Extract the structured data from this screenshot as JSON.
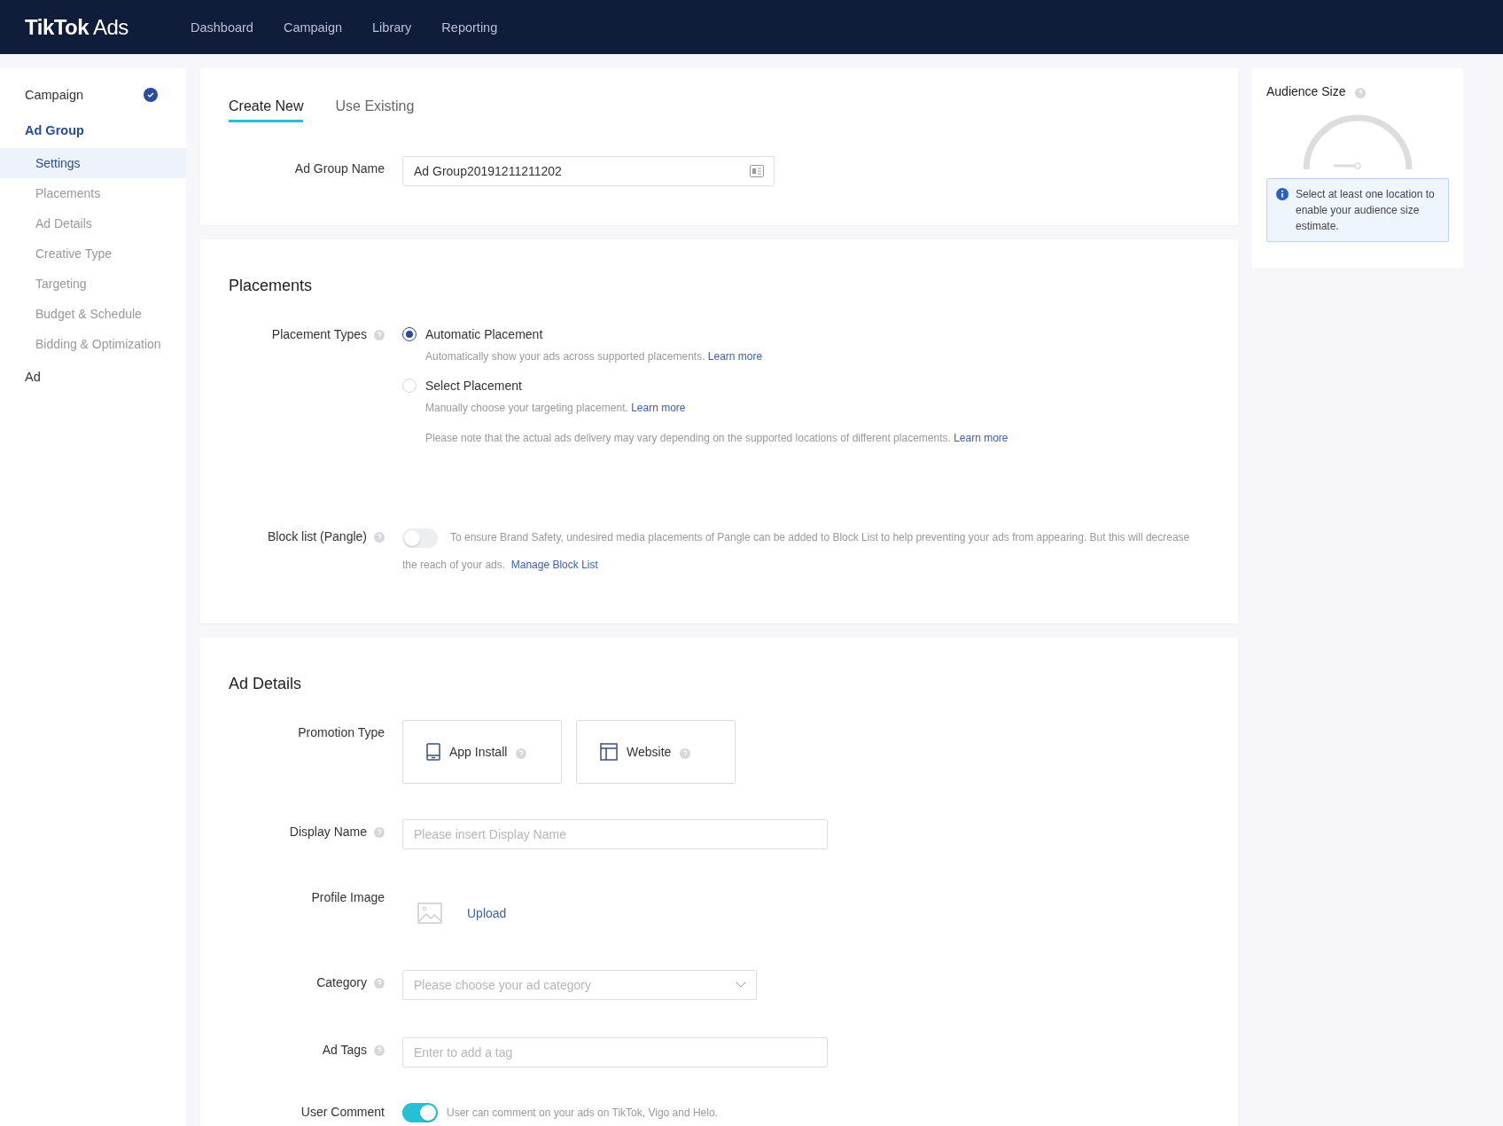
{
  "header": {
    "logo": "**TikTok** Ads",
    "nav": [
      {
        "label": "Dashboard",
        "selected": false
      },
      {
        "label": "Campaign",
        "selected": false
      },
      {
        "label": "Library",
        "selected": false
      },
      {
        "label": "Reporting",
        "selected": false
      }
    ]
  },
  "sidebar": {
    "steps": [
      {
        "label": "Campaign",
        "completed": true,
        "selected": false
      },
      {
        "label": "Ad Group",
        "completed": false,
        "selected": true,
        "children": [
          {
            "label": "Settings",
            "selected": true
          },
          {
            "label": "Placements",
            "selected": false
          },
          {
            "label": "Ad Details",
            "selected": false
          },
          {
            "label": "Creative Type",
            "selected": false
          },
          {
            "label": "Targeting",
            "selected": false
          },
          {
            "label": "Budget & Schedule",
            "selected": false
          },
          {
            "label": "Bidding & Optimization",
            "selected": false
          }
        ]
      },
      {
        "label": "Ad",
        "completed": false,
        "selected": false
      }
    ]
  },
  "tabs": [
    {
      "label": "Create New",
      "selected": true
    },
    {
      "label": "Use Existing",
      "selected": false
    }
  ],
  "ad_group_name": {
    "label": "Ad Group Name",
    "value": "Ad Group20191211211202"
  },
  "placements": {
    "title": "Placements",
    "placement_types": {
      "label": "Placement Types",
      "options": [
        {
          "label": "Automatic Placement",
          "description": "Automatically show your ads across supported placements.",
          "link": "Learn more",
          "selected": true
        },
        {
          "label": "Select Placement",
          "description": "Manually choose your targeting placement.",
          "link": "Learn more",
          "selected": false
        }
      ],
      "note": {
        "text": "Please note that the actual ads delivery may vary depending on the supported locations of different placements.",
        "link": "Learn more"
      }
    },
    "block_list": {
      "label": "Block list (Pangle)",
      "on": false,
      "text": "To ensure Brand Safety, undesired media placements of Pangle can be added to Block List to help preventing your ads from appearing. But this will decrease the reach of your ads.",
      "link": "Manage Block List"
    }
  },
  "ad_details": {
    "title": "Ad Details",
    "promotion_type": {
      "label": "Promotion Type",
      "options": [
        {
          "label": "App Install",
          "kind": "app",
          "selected": false
        },
        {
          "label": "Website",
          "kind": "website",
          "selected": false
        }
      ]
    },
    "display_name": {
      "label": "Display Name",
      "placeholder": "Please insert Display Name"
    },
    "profile_image": {
      "label": "Profile Image",
      "upload": "Upload"
    },
    "category": {
      "label": "Category",
      "placeholder": "Please choose your ad category"
    },
    "ad_tags": {
      "label": "Ad Tags",
      "placeholder": "Enter to add a tag"
    },
    "user_comment": {
      "label": "User Comment",
      "on": true,
      "text": "User can comment on your ads on TikTok, Vigo and Helo."
    }
  },
  "audience": {
    "title": "Audience Size",
    "message": "Select at least one location to enable your audience size estimate."
  }
}
